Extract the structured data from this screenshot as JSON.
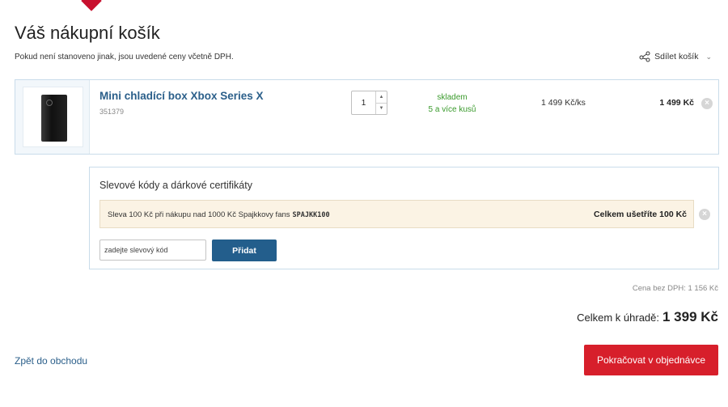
{
  "page": {
    "title": "Váš nákupní košík",
    "note": "Pokud není stanoveno jinak, jsou uvedené ceny včetně DPH.",
    "share_label": "Sdílet košík"
  },
  "item": {
    "name": "Mini chladící box Xbox Series X",
    "code": "351379",
    "quantity": "1",
    "stock_line1": "skladem",
    "stock_line2": "5 a více kusů",
    "unit_price": "1 499 Kč/ks",
    "total_price": "1 499 Kč"
  },
  "discount": {
    "title": "Slevové kódy a dárkové certifikáty",
    "applied_text": "Sleva 100 Kč při nákupu nad 1000 Kč Spajkkovy fans",
    "applied_code": "SPAJKK100",
    "saving": "Celkem ušetříte 100 Kč",
    "input_placeholder": "zadejte slevový kód",
    "add_label": "Přidat"
  },
  "summary": {
    "price_no_vat": "Cena bez DPH: 1 156 Kč",
    "total_label": "Celkem k úhradě:",
    "total_amount": "1 399 Kč"
  },
  "footer": {
    "back_label": "Zpět do obchodu",
    "continue_label": "Pokračovat v objednávce"
  },
  "colors": {
    "accent": "#d71f2b",
    "link": "#2b5f8a",
    "button": "#235e8c",
    "stock": "#3a9a2c"
  }
}
